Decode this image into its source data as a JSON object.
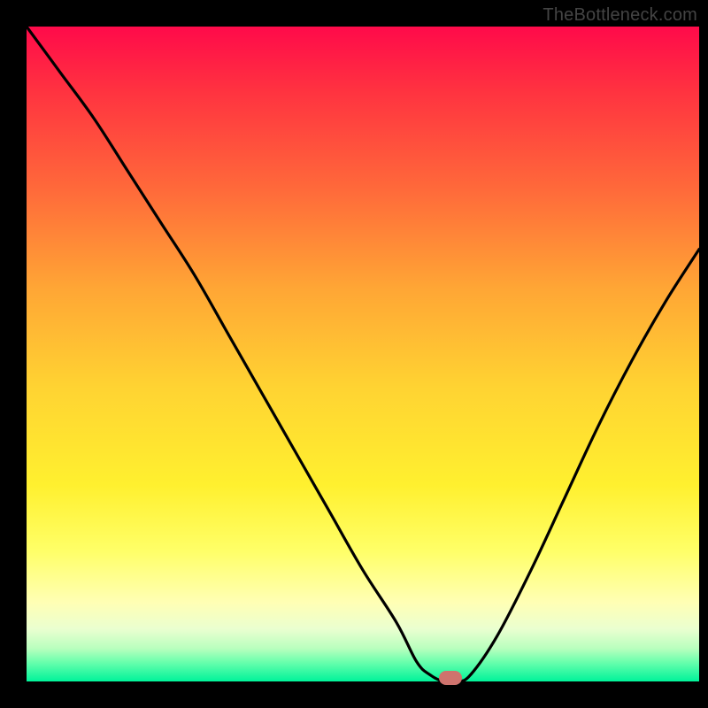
{
  "watermark": "TheBottleneck.com",
  "chart_data": {
    "type": "line",
    "title": "",
    "xlabel": "",
    "ylabel": "",
    "xlim": [
      0,
      100
    ],
    "ylim": [
      0,
      100
    ],
    "grid": false,
    "legend": false,
    "series": [
      {
        "name": "bottleneck-curve",
        "x": [
          0,
          5,
          10,
          15,
          20,
          25,
          30,
          35,
          40,
          45,
          50,
          55,
          58,
          60,
          62,
          64,
          66,
          70,
          75,
          80,
          85,
          90,
          95,
          100
        ],
        "values": [
          100,
          93,
          86,
          78,
          70,
          62,
          53,
          44,
          35,
          26,
          17,
          9,
          3,
          1,
          0,
          0,
          1,
          7,
          17,
          28,
          39,
          49,
          58,
          66
        ]
      }
    ],
    "marker": {
      "x": 63,
      "y": 0,
      "color": "#cf736d"
    },
    "background_gradient": {
      "top": "#ff0a4a",
      "bottom": "#00f39a"
    }
  }
}
